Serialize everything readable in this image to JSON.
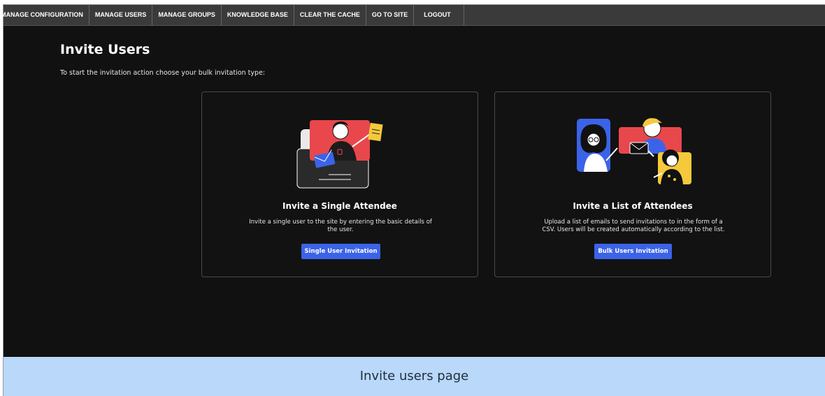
{
  "nav": {
    "items": [
      {
        "label": "MANAGE CONFIGURATION"
      },
      {
        "label": "MANAGE USERS"
      },
      {
        "label": "MANAGE GROUPS"
      },
      {
        "label": "KNOWLEDGE BASE"
      },
      {
        "label": "CLEAR THE CACHE"
      },
      {
        "label": "GO TO SITE"
      },
      {
        "label": "LOGOUT"
      }
    ]
  },
  "page": {
    "title": "Invite Users",
    "intro": "To start the invitation action choose your bulk invitation type:"
  },
  "cards": [
    {
      "title": "Invite a Single Attendee",
      "description": "Invite a single user to the site by entering the basic details of the user.",
      "button": "Single User Invitation",
      "illustration": "single-attendee-illustration"
    },
    {
      "title": "Invite a List of Attendees",
      "description": "Upload a list of emails to send invitations to in the form of a CSV. Users will be created automatically according to the list.",
      "button": "Bulk Users Invitation",
      "illustration": "attendee-list-illustration"
    }
  ],
  "caption": "Invite users page",
  "colors": {
    "background": "#111111",
    "nav": "#3a3a3a",
    "button": "#3b63e8",
    "accent_red": "#e8474c",
    "accent_blue": "#3b63e8",
    "accent_yellow": "#f5c93b",
    "caption_bg": "#b9d8fa"
  }
}
